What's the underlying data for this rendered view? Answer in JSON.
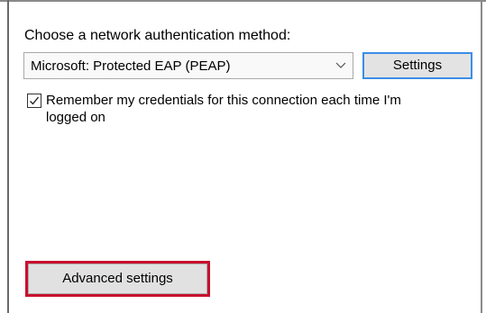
{
  "authentication": {
    "label": "Choose a network authentication method:",
    "selected_method": "Microsoft: Protected EAP (PEAP)",
    "settings_button": "Settings"
  },
  "remember_credentials": {
    "checked": true,
    "label": "Remember my credentials for this connection each time I'm logged on"
  },
  "advanced_settings_button": "Advanced settings",
  "icons": {
    "dropdown": "chevron-down-icon",
    "checkbox": "checkmark-icon"
  },
  "colors": {
    "settings_focus_border": "#3a8ee6",
    "advanced_highlight": "#c8102e",
    "button_face": "#e1e1e1"
  }
}
